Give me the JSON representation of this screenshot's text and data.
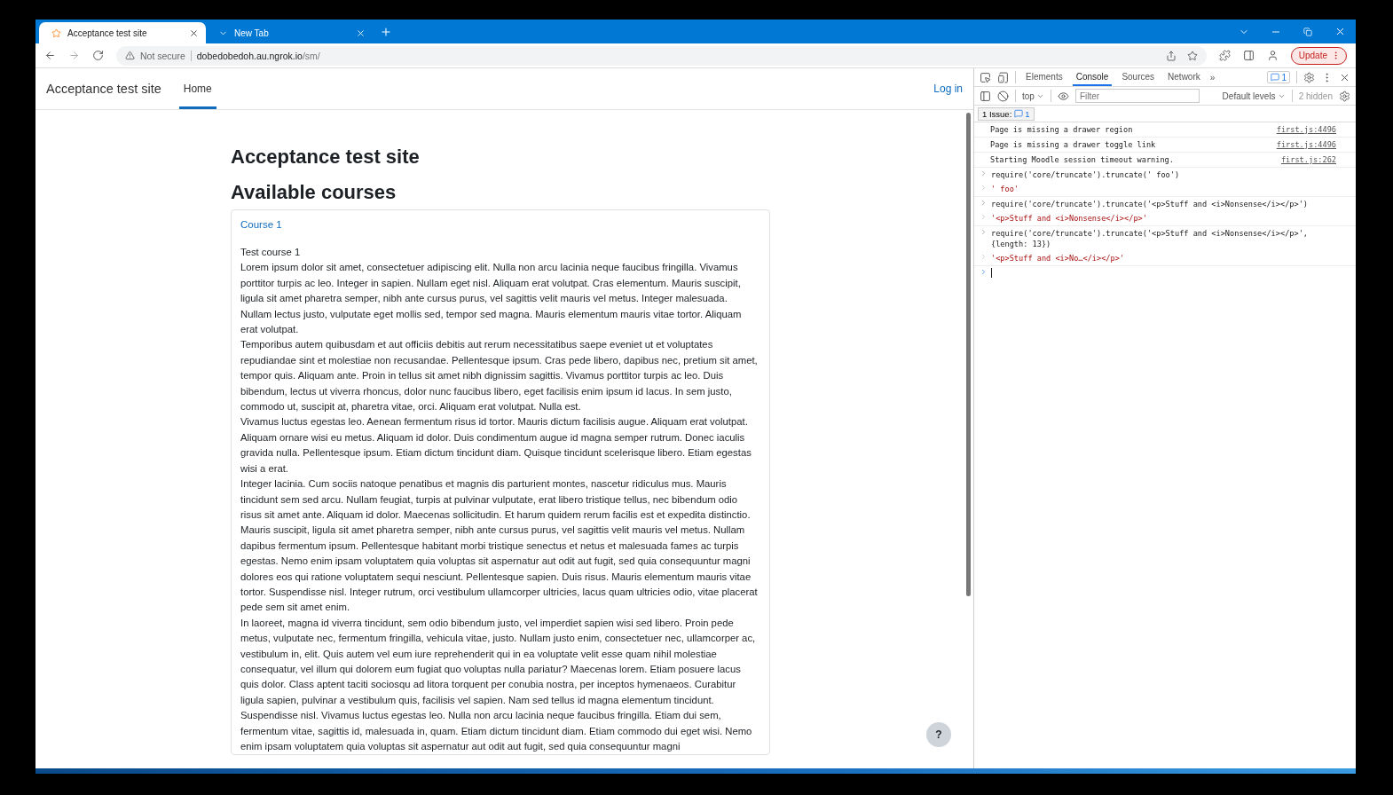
{
  "browser": {
    "tabs": [
      {
        "title": "Acceptance test site",
        "selected": true
      },
      {
        "title": "New Tab",
        "selected": false
      }
    ],
    "address": {
      "security": "Not secure",
      "host": "dobedobedoh.au.ngrok.io",
      "path": "/sm/"
    },
    "update_button": "Update"
  },
  "page": {
    "navbar": {
      "brand": "Acceptance test site",
      "nav": [
        {
          "label": "Home",
          "selected": true
        }
      ],
      "login": "Log in"
    },
    "heading": "Acceptance test site",
    "section_heading": "Available courses",
    "course": {
      "title": "Course 1",
      "summary": [
        "Test course 1",
        "Lorem ipsum dolor sit amet, consectetuer adipiscing elit. Nulla non arcu lacinia neque faucibus fringilla. Vivamus porttitor turpis ac leo. Integer in sapien. Nullam eget nisl. Aliquam erat volutpat. Cras elementum. Mauris suscipit, ligula sit amet pharetra semper, nibh ante cursus purus, vel sagittis velit mauris vel metus. Integer malesuada. Nullam lectus justo, vulputate eget mollis sed, tempor sed magna. Mauris elementum mauris vitae tortor. Aliquam erat volutpat.",
        "Temporibus autem quibusdam et aut officiis debitis aut rerum necessitatibus saepe eveniet ut et voluptates repudiandae sint et molestiae non recusandae. Pellentesque ipsum. Cras pede libero, dapibus nec, pretium sit amet, tempor quis. Aliquam ante. Proin in tellus sit amet nibh dignissim sagittis. Vivamus porttitor turpis ac leo. Duis bibendum, lectus ut viverra rhoncus, dolor nunc faucibus libero, eget facilisis enim ipsum id lacus. In sem justo, commodo ut, suscipit at, pharetra vitae, orci. Aliquam erat volutpat. Nulla est.",
        "Vivamus luctus egestas leo. Aenean fermentum risus id tortor. Mauris dictum facilisis augue. Aliquam erat volutpat. Aliquam ornare wisi eu metus. Aliquam id dolor. Duis condimentum augue id magna semper rutrum. Donec iaculis gravida nulla. Pellentesque ipsum. Etiam dictum tincidunt diam. Quisque tincidunt scelerisque libero. Etiam egestas wisi a erat.",
        "Integer lacinia. Cum sociis natoque penatibus et magnis dis parturient montes, nascetur ridiculus mus. Mauris tincidunt sem sed arcu. Nullam feugiat, turpis at pulvinar vulputate, erat libero tristique tellus, nec bibendum odio risus sit amet ante. Aliquam id dolor. Maecenas sollicitudin. Et harum quidem rerum facilis est et expedita distinctio. Mauris suscipit, ligula sit amet pharetra semper, nibh ante cursus purus, vel sagittis velit mauris vel metus. Nullam dapibus fermentum ipsum. Pellentesque habitant morbi tristique senectus et netus et malesuada fames ac turpis egestas. Nemo enim ipsam voluptatem quia voluptas sit aspernatur aut odit aut fugit, sed quia consequuntur magni dolores eos qui ratione voluptatem sequi nesciunt. Pellentesque sapien. Duis risus. Mauris elementum mauris vitae tortor. Suspendisse nisl. Integer rutrum, orci vestibulum ullamcorper ultricies, lacus quam ultricies odio, vitae placerat pede sem sit amet enim.",
        "In laoreet, magna id viverra tincidunt, sem odio bibendum justo, vel imperdiet sapien wisi sed libero. Proin pede metus, vulputate nec, fermentum fringilla, vehicula vitae, justo. Nullam justo enim, consectetuer nec, ullamcorper ac, vestibulum in, elit. Quis autem vel eum iure reprehenderit qui in ea voluptate velit esse quam nihil molestiae consequatur, vel illum qui dolorem eum fugiat quo voluptas nulla pariatur? Maecenas lorem. Etiam posuere lacus quis dolor. Class aptent taciti sociosqu ad litora torquent per conubia nostra, per inceptos hymenaeos. Curabitur ligula sapien, pulvinar a vestibulum quis, facilisis vel sapien. Nam sed tellus id magna elementum tincidunt. Suspendisse nisl. Vivamus luctus egestas leo. Nulla non arcu lacinia neque faucibus fringilla. Etiam dui sem, fermentum vitae, sagittis id, malesuada in, quam. Etiam dictum tincidunt diam. Etiam commodo dui eget wisi. Nemo enim ipsam voluptatem quia voluptas sit aspernatur aut odit aut fugit, sed quia consequuntur magni"
      ]
    },
    "help_button": "?"
  },
  "devtools": {
    "tabs": [
      {
        "label": "Elements",
        "selected": false
      },
      {
        "label": "Console",
        "selected": true
      },
      {
        "label": "Sources",
        "selected": false
      },
      {
        "label": "Network",
        "selected": false
      }
    ],
    "more": "»",
    "issues_badge": "1",
    "context": "top",
    "filter_placeholder": "Filter",
    "levels": "Default levels",
    "hidden": "2 hidden",
    "issue_bar": {
      "label": "1 Issue:",
      "count": "1"
    },
    "messages": [
      {
        "kind": "log",
        "text": "Page is missing a drawer region",
        "source": "first.js:4496"
      },
      {
        "kind": "log",
        "text": "Page is missing a drawer toggle link",
        "source": "first.js:4496"
      },
      {
        "kind": "log",
        "text": "Starting Moodle session timeout warning.",
        "source": "first.js:262"
      },
      {
        "kind": "input",
        "text": "require('core/truncate').truncate(' foo')"
      },
      {
        "kind": "result",
        "text": "' foo'"
      },
      {
        "kind": "input",
        "text": "require('core/truncate').truncate('<p>Stuff and <i>Nonsense</i></p>')"
      },
      {
        "kind": "result",
        "text": "'<p>Stuff and <i>Nonsense</i></p>'"
      },
      {
        "kind": "input",
        "text": "require('core/truncate').truncate('<p>Stuff and <i>Nonsense</i></p>',\n{length: 13})"
      },
      {
        "kind": "result",
        "text": "'<p>Stuff and <i>No…</i></p>'"
      },
      {
        "kind": "prompt"
      }
    ]
  }
}
